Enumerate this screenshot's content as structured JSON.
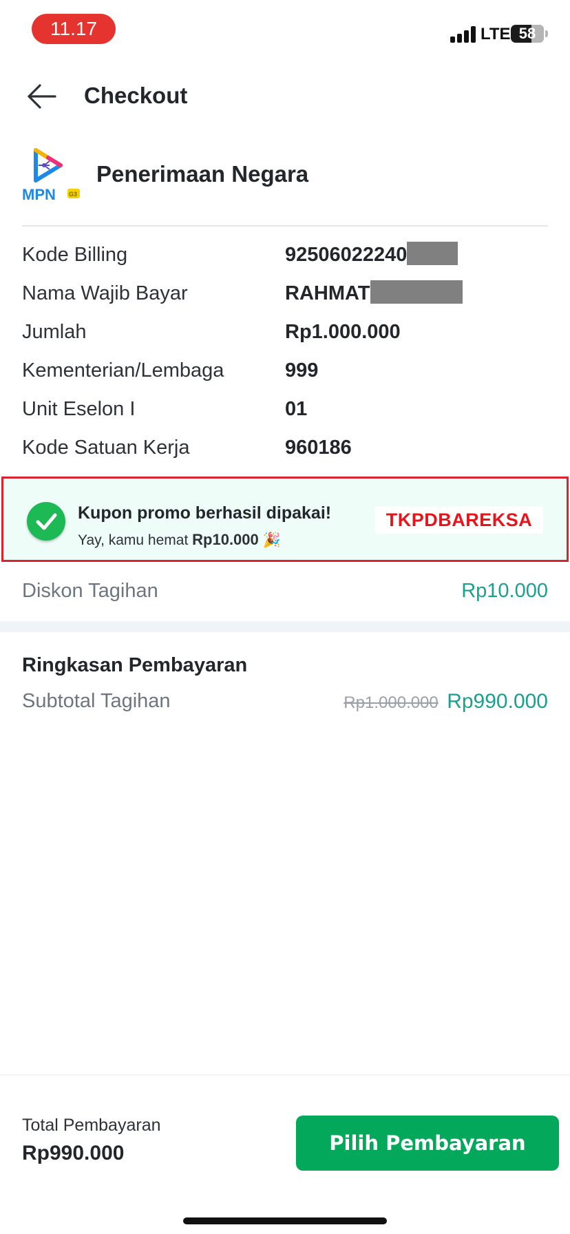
{
  "status_bar": {
    "time": "11.17",
    "network": "LTE",
    "battery": "58",
    "colors": {
      "time_pill": "#e5332f"
    }
  },
  "header": {
    "title": "Checkout",
    "back_icon": "arrow-left-icon"
  },
  "merchant": {
    "logo_text": "MPN",
    "logo_badge": "G3",
    "name": "Penerimaan Negara"
  },
  "details": [
    {
      "label": "Kode Billing",
      "value": "92506022240",
      "redacted": true
    },
    {
      "label": "Nama Wajib Bayar",
      "value": "RAHMAT",
      "redacted": true
    },
    {
      "label": "Jumlah",
      "value": "Rp1.000.000"
    },
    {
      "label": "Kementerian/Lembaga",
      "value": "999"
    },
    {
      "label": "Unit Eselon I",
      "value": "01"
    },
    {
      "label": "Kode Satuan Kerja",
      "value": "960186"
    }
  ],
  "promo": {
    "icon": "check-circle-icon",
    "title": "Kupon promo berhasil dipakai!",
    "subtitle_prefix": "Yay, kamu hemat",
    "subtitle_amount": "Rp10.000",
    "subtitle_emoji": "🎉",
    "code": "TKPDBAREKSA",
    "colors": {
      "border": "#d9232e",
      "background": "#effdf9",
      "code_text": "#e8141c"
    }
  },
  "discount": {
    "label": "Diskon Tagihan",
    "value": "Rp10.000"
  },
  "summary": {
    "title": "Ringkasan Pembayaran",
    "subtotal_label": "Subtotal Tagihan",
    "subtotal_original": "Rp1.000.000",
    "subtotal_final": "Rp990.000",
    "colors": {
      "accent": "#1aa08f"
    }
  },
  "footer": {
    "total_label": "Total Pembayaran",
    "total_value": "Rp990.000",
    "button_label": "Pilih Pembayaran",
    "colors": {
      "button": "#03a85a"
    }
  }
}
